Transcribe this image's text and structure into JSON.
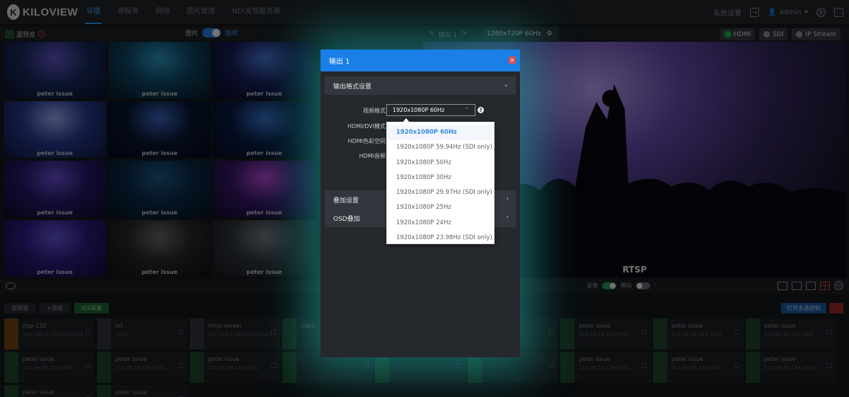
{
  "logo": {
    "mark": "K",
    "text": "KILOVIEW"
  },
  "nav": {
    "items": [
      "导播",
      "源服务",
      "网络",
      "图片管理",
      "NDI发现服务器"
    ]
  },
  "top_right": {
    "settings": "系统设置",
    "user": "admin",
    "user_caret": "▾",
    "info_icon": "i"
  },
  "preview": {
    "label": "源预览",
    "pic_label": "图片",
    "video_label": "视频",
    "output_chip": "输出 1",
    "resolution": "1280x720P 60Hz"
  },
  "outputs": [
    {
      "label": "HDMI",
      "active": true
    },
    {
      "label": "SDI",
      "active": false
    },
    {
      "label": "IP Stream",
      "active": false
    }
  ],
  "tiles": [
    {
      "label": "peter issue",
      "colors": [
        "#1b2e66",
        "#6a5ad6",
        "#0d1229"
      ]
    },
    {
      "label": "peter issue",
      "colors": [
        "#0f4b6d",
        "#2ea0c9",
        "#071a24"
      ]
    },
    {
      "label": "peter issue",
      "colors": [
        "#1a2060",
        "#4f7be2",
        "#090c22"
      ]
    },
    {
      "label": "peter issue",
      "colors": [
        "#2b3c9a",
        "#9fb2ff",
        "#10173d"
      ]
    },
    {
      "label": "peter issue",
      "colors": [
        "#0a1838",
        "#3e6bc9",
        "#050b1c"
      ]
    },
    {
      "label": "peter issue",
      "colors": [
        "#0c1e4a",
        "#3d78d6",
        "#060d20"
      ]
    },
    {
      "label": "peter issue",
      "colors": [
        "#2a1a70",
        "#7052e0",
        "#0f0a2e"
      ]
    },
    {
      "label": "peter issue",
      "colors": [
        "#0c2e4e",
        "#1e5f8c",
        "#061421"
      ]
    },
    {
      "label": "peter issue",
      "colors": [
        "#3a1a70",
        "#c04ae0",
        "#150a2e"
      ]
    },
    {
      "label": "peter issue",
      "colors": [
        "#2c1e88",
        "#6b5ae8",
        "#120c3a"
      ]
    },
    {
      "label": "peter issue",
      "colors": [
        "#2a2a2a",
        "#6e6e6e",
        "#111111"
      ]
    },
    {
      "label": "peter issue",
      "colors": [
        "#333840",
        "#7b828c",
        "#15181c"
      ]
    }
  ],
  "big_preview": {
    "label": "RTSP"
  },
  "status_bar": {
    "record_label": "录像",
    "sim_label": "模拟"
  },
  "sources_toolbar": {
    "video_source": "视频源",
    "add": "+添加",
    "ios": "iOS采集",
    "multi_select": "打开多选控制"
  },
  "sources": [
    {
      "name": "rtsp-132",
      "addr": "192.168.2.132:554/ch01",
      "type": "orange"
    },
    {
      "name": "srt",
      "addr": "1825",
      "type": "gray"
    },
    {
      "name": "rtmp-server",
      "addr": "192.168.2.200:1935/live/...",
      "type": "gray"
    },
    {
      "name": "udp1",
      "addr": "",
      "type": "green"
    },
    {
      "name": "",
      "addr": "",
      "type": "gray"
    },
    {
      "name": "",
      "addr": "",
      "type": "gray"
    },
    {
      "name": "peter issue",
      "addr": "212.69.59.123:7001",
      "type": "green"
    },
    {
      "name": "peter issue",
      "addr": "212.69.59.123:7001",
      "type": "green"
    },
    {
      "name": "peter issue",
      "addr": "212.69.59.123:7001",
      "type": "green"
    },
    {
      "name": "peter issue",
      "addr": "212.69.59.123:7001",
      "type": "green"
    },
    {
      "name": "peter issue",
      "addr": "212.69.59.123:7001",
      "type": "green"
    },
    {
      "name": "peter issue",
      "addr": "212.69.59.123:7001",
      "type": "green"
    },
    {
      "name": "",
      "addr": "",
      "type": "green"
    },
    {
      "name": "",
      "addr": "",
      "type": "green"
    },
    {
      "name": "",
      "addr": "",
      "type": "green"
    },
    {
      "name": "peter issue",
      "addr": "212.69.59.123:7001",
      "type": "green"
    },
    {
      "name": "peter issue",
      "addr": "212.69.59.123:7001",
      "type": "green"
    },
    {
      "name": "peter issue",
      "addr": "212.69.59.123:7001",
      "type": "green"
    },
    {
      "name": "peter issue",
      "addr": "",
      "type": "green"
    },
    {
      "name": "peter issue",
      "addr": "",
      "type": "green"
    }
  ],
  "modal": {
    "title": "输出 1",
    "close_icon": "✕",
    "section_format": "输出格式设置",
    "video_format_label": "视频格式",
    "video_format_value": "1920x1080P 60Hz",
    "hdmi_dvi_label": "HDMI/DVI模式",
    "hdmi_color_label": "HDMI色彩空间",
    "hdmi_audio_label": "HDMI音频",
    "section_overlay": "叠加设置",
    "section_osd": "OSD叠加",
    "help_icon": "?"
  },
  "dropdown": {
    "selected_index": 0,
    "options": [
      "1920x1080P 60Hz",
      "1920x1080P 59.94Hz (SDI only)",
      "1920x1080P 50Hz",
      "1920x1080P 30Hz",
      "1920x1080P 29.97Hz (SDI only)",
      "1920x1080P 25Hz",
      "1920x1080P 24Hz",
      "1920x1080P 23.98Hz (SDI only)"
    ]
  },
  "colors": {
    "accent": "#1a7fe6",
    "selected_option": "#3a8ee6",
    "glow": "#28dcd2",
    "active_output": "#1fbf4a"
  }
}
